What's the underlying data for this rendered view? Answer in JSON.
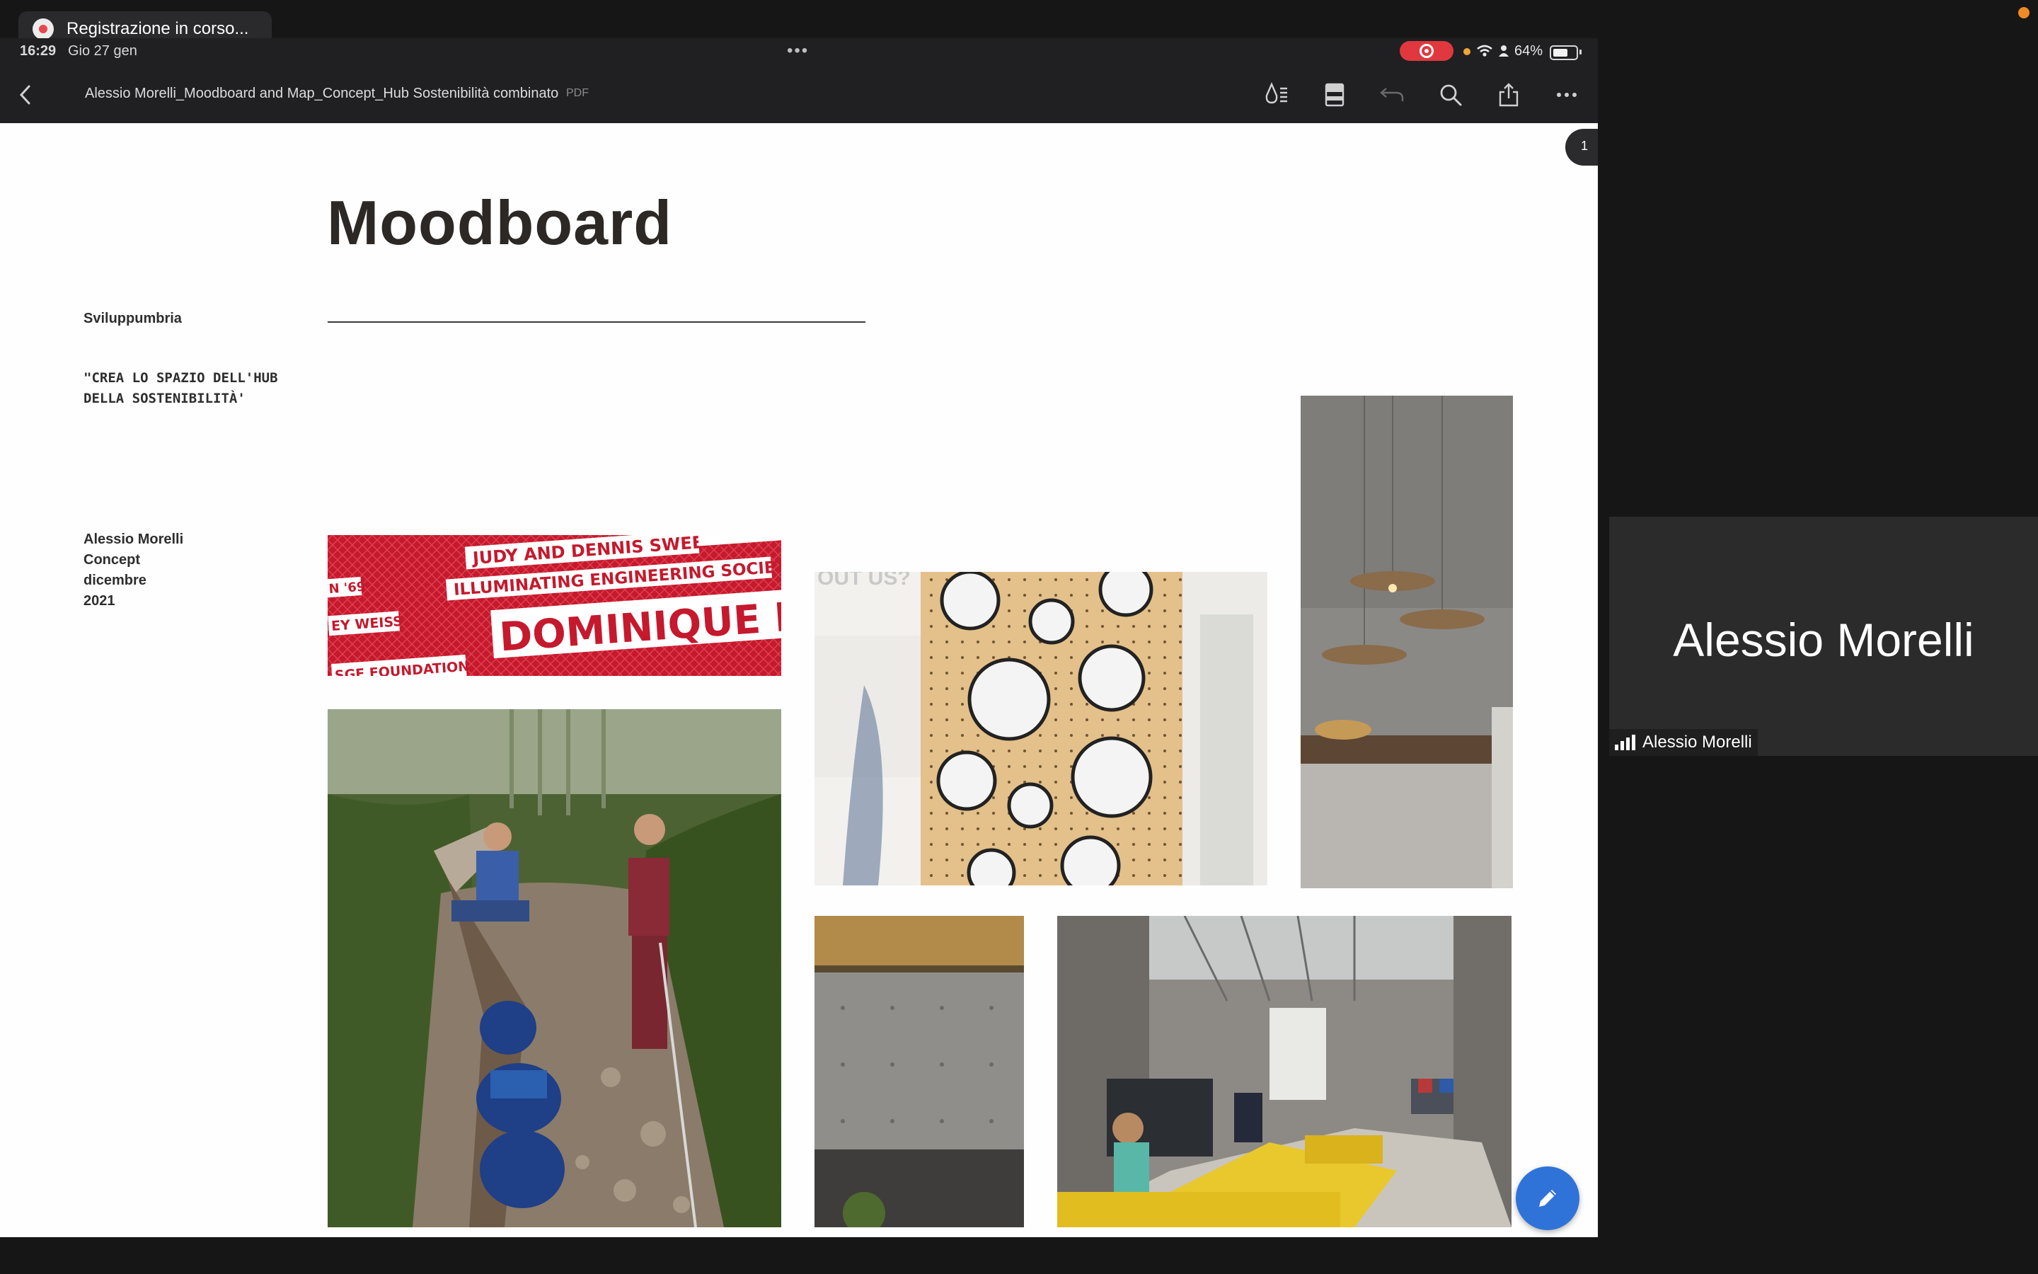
{
  "recording": {
    "label": "Registrazione in corso..."
  },
  "status_bar": {
    "time": "16:29",
    "date": "Gio 27 gen",
    "battery": "64%"
  },
  "toolbar": {
    "back_icon": "chevron-left-icon",
    "document_title": "Alessio Morelli_Moodboard and Map_Concept_Hub Sostenibilità combinato",
    "document_type": "PDF",
    "icons": [
      "markup-icon",
      "page-layout-icon",
      "undo-icon",
      "search-icon",
      "share-icon",
      "more-icon"
    ]
  },
  "page": {
    "number": "1",
    "title": "Moodboard",
    "brand": "Sviluppumbria",
    "tagline": "\"CREA LO SPAZIO DELL'HUB DELLA SOSTENIBILITÀ'",
    "credits": [
      "Alessio Morelli",
      "Concept",
      "dicembre",
      "2021"
    ],
    "sign_lines": [
      "JUDY AND DENNIS SWEENEY",
      "ILLUMINATING ENGINEERING SOCIETY",
      "DOMINIQUE BLUHDORN",
      "N '69",
      "EY WEISS",
      "SGE FOUNDATION",
      "OUT US?"
    ]
  },
  "participant": {
    "name": "Alessio Morelli"
  },
  "colors": {
    "record_red": "#e0383e",
    "fab_blue": "#2f73d9",
    "accent_yellow": "#e8c82c"
  }
}
